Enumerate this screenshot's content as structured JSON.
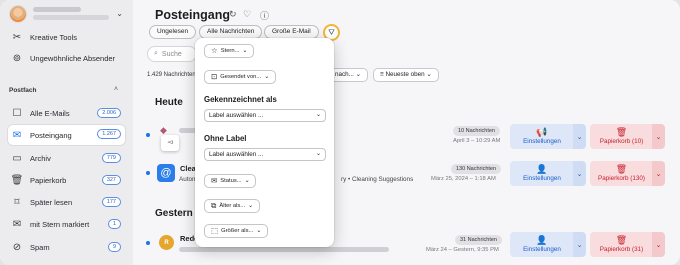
{
  "sidebar": {
    "kreative_tools": "Kreative Tools",
    "ungewoehnliche": "Ungewöhnliche Absender",
    "section": "Postfach",
    "items": [
      {
        "label": "Alle E-Mails",
        "badge": "2.006"
      },
      {
        "label": "Posteingang",
        "badge": "1.267"
      },
      {
        "label": "Archiv",
        "badge": "779"
      },
      {
        "label": "Papierkorb",
        "badge": "327"
      },
      {
        "label": "Später lesen",
        "badge": "177"
      },
      {
        "label": "mit Stern markiert",
        "badge": "1"
      },
      {
        "label": "Spam",
        "badge": "9"
      }
    ]
  },
  "header": {
    "title": "Posteingang"
  },
  "chips": [
    "Ungelesen",
    "Alle Nachrichten",
    "Große E-Mail"
  ],
  "search": {
    "placeholder": "Suche"
  },
  "list_count": "1.429 Nachrichten",
  "controls": {
    "sort_partial": "nach...",
    "sort": "Neueste oben"
  },
  "groups": {
    "today": "Heute",
    "yesterday": "Gestern"
  },
  "rows": [
    {
      "sender": "",
      "snippet": "",
      "count": "10 Nachrichten",
      "date": "April 3 – 10:29 AM",
      "settings": "Einstellungen",
      "trash": "Papierkorb (10)"
    },
    {
      "sender": "Clea",
      "snippet_left": "Autom",
      "snippet_right": "ry • Cleaning Suggestions",
      "count": "130 Nachrichten",
      "date": "März 25, 2024 – 1:18 AM",
      "settings": "Einstellungen",
      "trash": "Papierkorb (130)"
    },
    {
      "sender": "Redc",
      "avatar": "R",
      "count": "31 Nachrichten",
      "date": "März 24 – Gestern, 9:35 PM",
      "settings": "Einstellungen",
      "trash": "Papierkorb (31)"
    }
  ],
  "popover": {
    "stern": "Stern...",
    "gesendet": "Gesendet von...",
    "gekennzeichnet_label": "Gekennzeichnet als",
    "gekennzeichnet_select": "Label auswählen ...",
    "ohne_label": "Ohne Label",
    "ohne_select": "Label auswählen ...",
    "status": "Status...",
    "aelter": "Älter als...",
    "groesser": "Größer als..."
  },
  "colors": {
    "accent": "#1a73e8",
    "filter_ring": "#f2b53a",
    "danger": "#c4222e"
  }
}
